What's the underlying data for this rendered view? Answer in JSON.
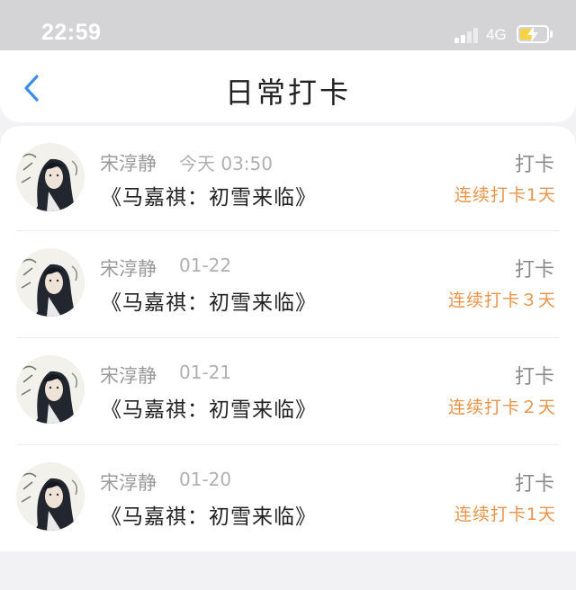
{
  "status_bar": {
    "time": "22:59",
    "network": "4G",
    "battery_level": 0.45,
    "battery_color": "#f6d33f"
  },
  "nav": {
    "back_icon": "chevron-left-icon",
    "title": "日常打卡",
    "accent_color": "#3a8ee6"
  },
  "checkins": [
    {
      "user": "宋淳静",
      "time": "今天 03:50",
      "title": "《马嘉祺：初雪来临》",
      "action": "打卡",
      "streak": "连续打卡1天"
    },
    {
      "user": "宋淳静",
      "time": "01-22",
      "title": "《马嘉祺：初雪来临》",
      "action": "打卡",
      "streak": "连续打卡３天"
    },
    {
      "user": "宋淳静",
      "time": "01-21",
      "title": "《马嘉祺：初雪来临》",
      "action": "打卡",
      "streak": "连续打卡２天"
    },
    {
      "user": "宋淳静",
      "time": "01-20",
      "title": "《马嘉祺：初雪来临》",
      "action": "打卡",
      "streak": "连续打卡1天"
    }
  ],
  "streak_color": "#e8944a"
}
